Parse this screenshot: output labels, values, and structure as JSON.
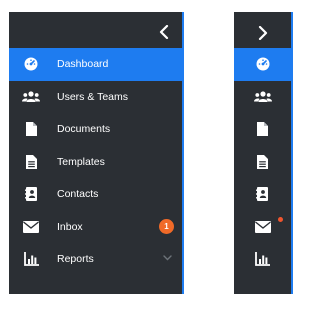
{
  "expanded_nav": {
    "collapse_icon": "chevron-left-icon",
    "items": [
      {
        "label": "Dashboard",
        "icon": "speedometer-icon",
        "active": true
      },
      {
        "label": "Users & Teams",
        "icon": "users-icon"
      },
      {
        "label": "Documents",
        "icon": "document-icon"
      },
      {
        "label": "Templates",
        "icon": "template-icon"
      },
      {
        "label": "Contacts",
        "icon": "contact-book-icon"
      },
      {
        "label": "Inbox",
        "icon": "envelope-icon",
        "badge": "1"
      },
      {
        "label": "Reports",
        "icon": "bar-chart-icon",
        "expandable": true
      }
    ]
  },
  "collapsed_nav": {
    "expand_icon": "chevron-right-icon",
    "notification_dot": true
  },
  "colors": {
    "panel_bg": "#2b2f34",
    "accent": "#1e7cf0",
    "badge": "#f06a28",
    "text": "#ffffff"
  }
}
